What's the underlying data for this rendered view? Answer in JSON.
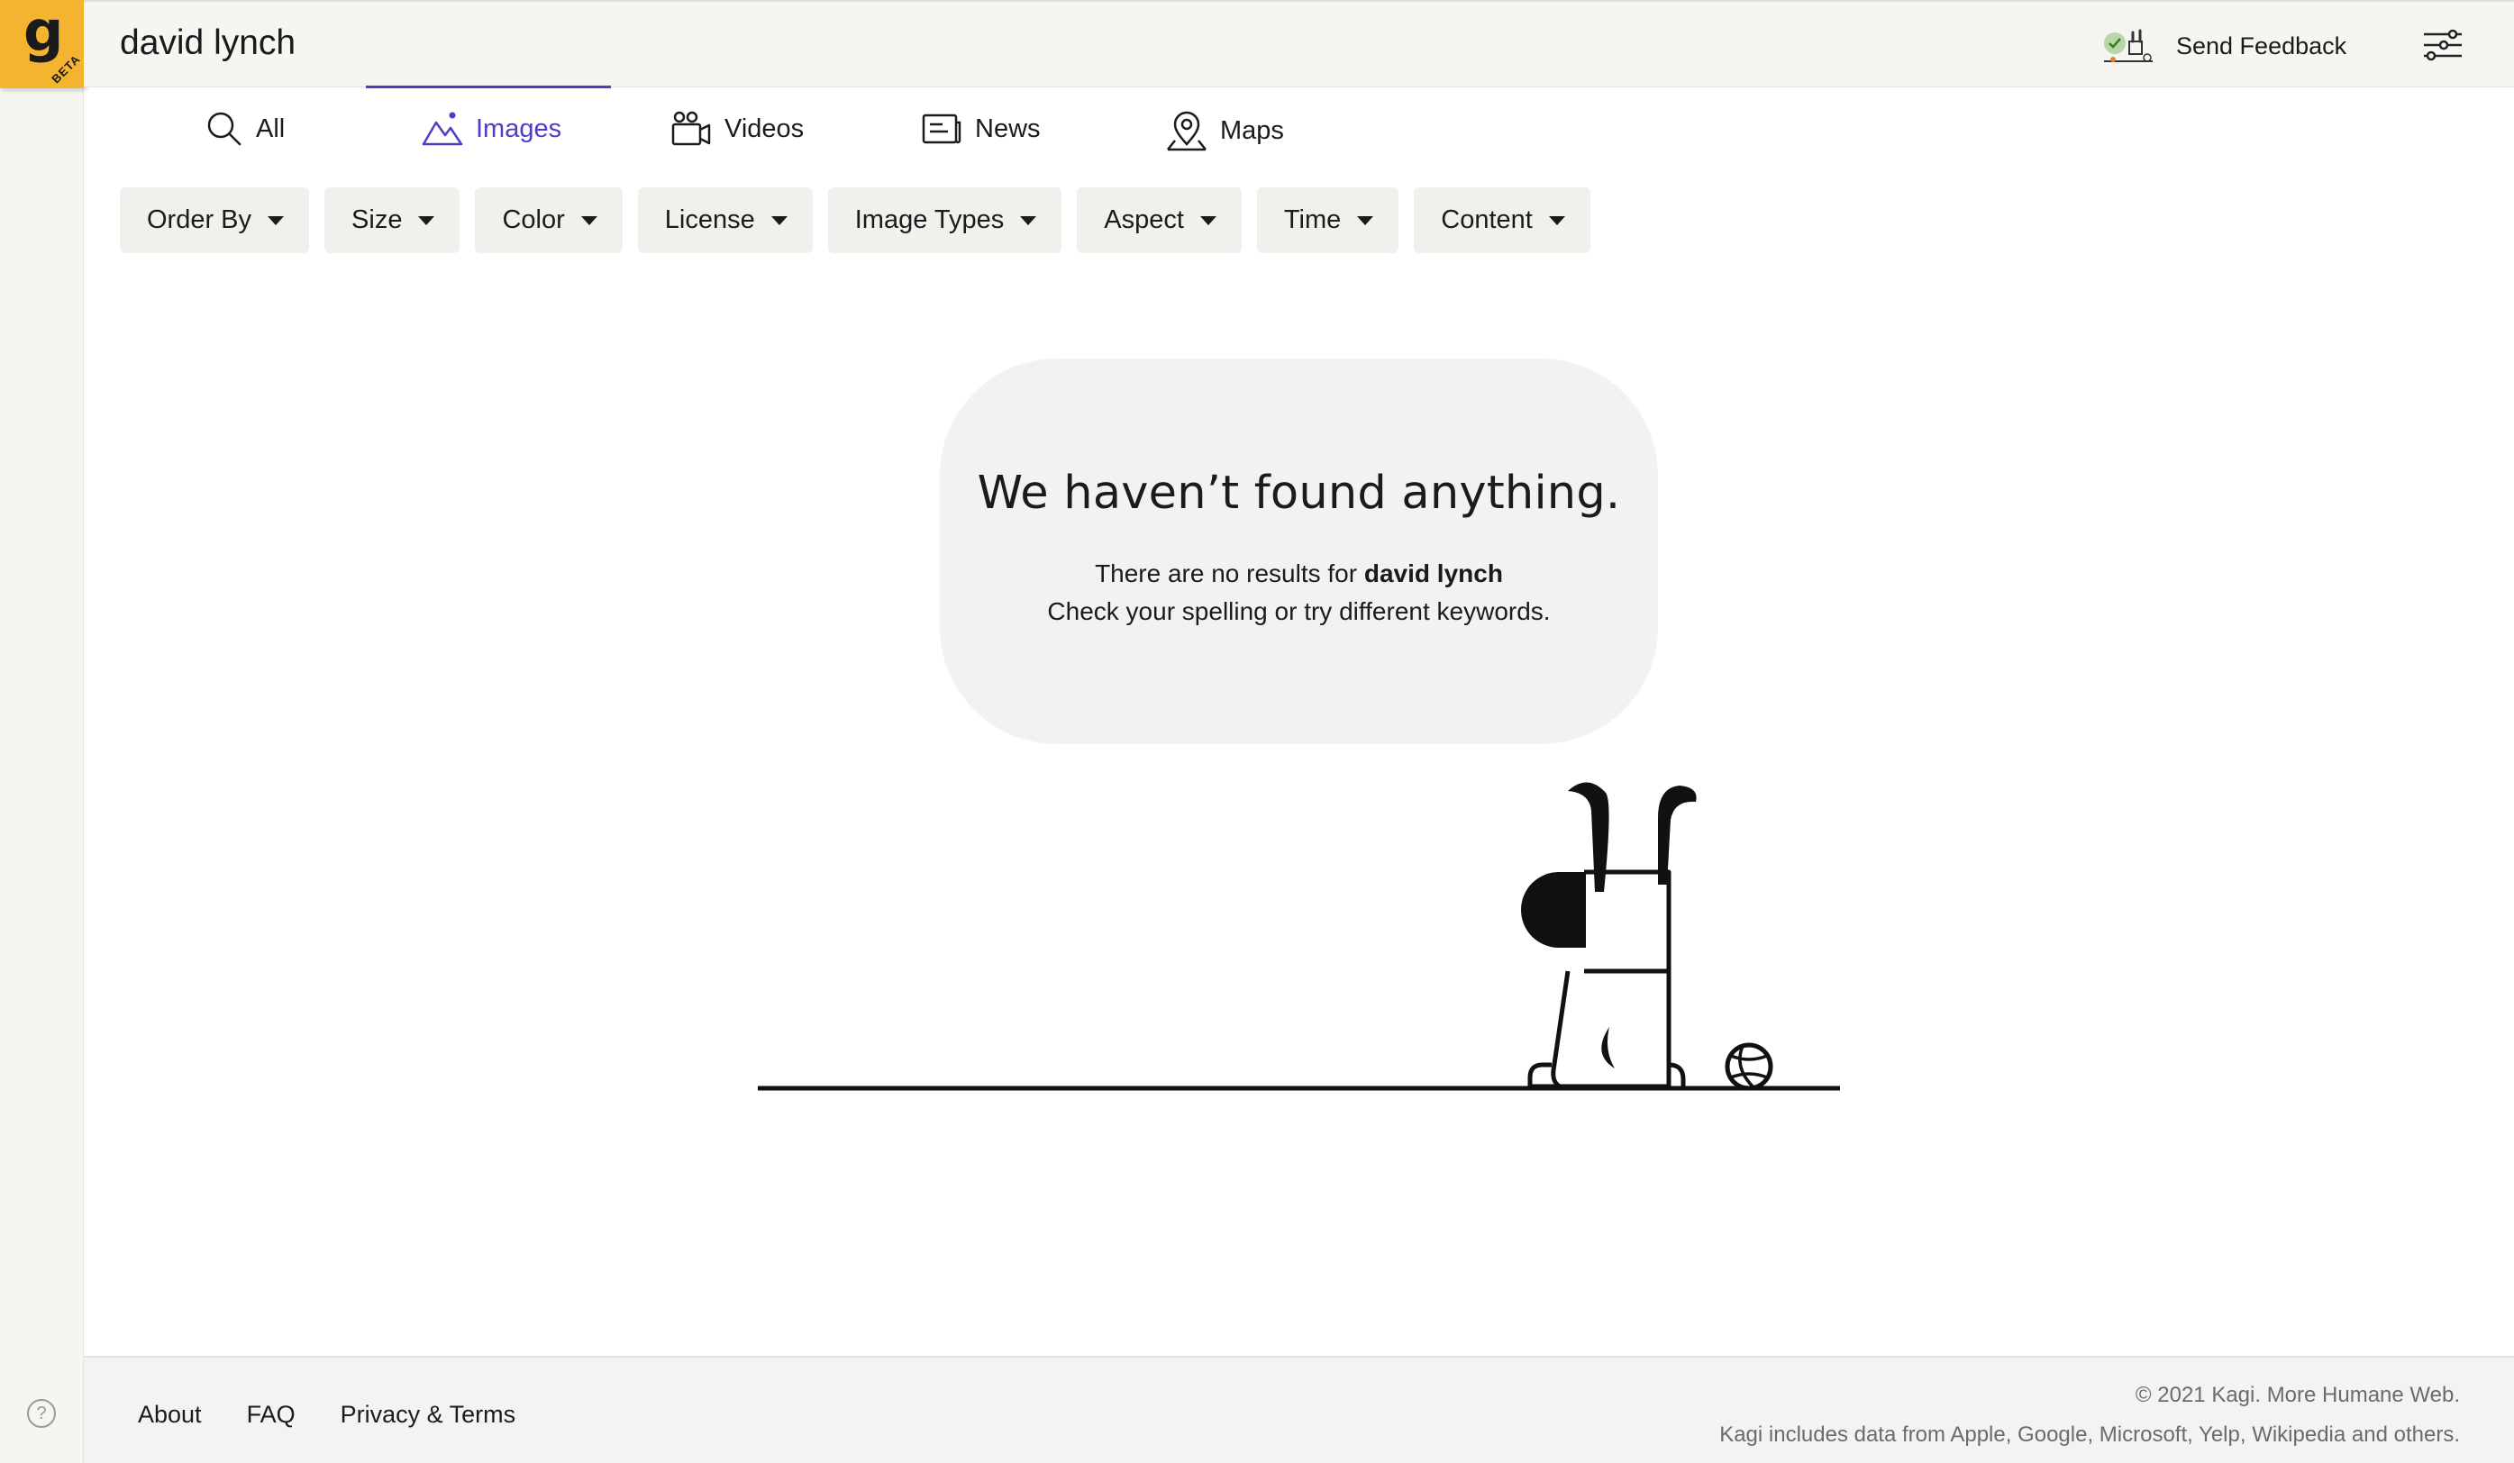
{
  "app": {
    "logo_letter": "g",
    "badge": "BETA",
    "query": "david lynch",
    "help_glyph": "?"
  },
  "header": {
    "feedback_label": "Send Feedback",
    "feedback_icon": "feedback-illustration-icon",
    "settings_icon": "settings-sliders-icon"
  },
  "tabs": [
    {
      "label": "All",
      "icon": "search-icon",
      "active": false
    },
    {
      "label": "Images",
      "icon": "image-icon",
      "active": true
    },
    {
      "label": "Videos",
      "icon": "video-camera-icon",
      "active": false
    },
    {
      "label": "News",
      "icon": "news-icon",
      "active": false
    },
    {
      "label": "Maps",
      "icon": "map-pin-icon",
      "active": false
    }
  ],
  "filters": [
    {
      "label": "Order By"
    },
    {
      "label": "Size"
    },
    {
      "label": "Color"
    },
    {
      "label": "License"
    },
    {
      "label": "Image Types"
    },
    {
      "label": "Aspect"
    },
    {
      "label": "Time"
    },
    {
      "label": "Content"
    }
  ],
  "empty_state": {
    "title": "We haven’t found anything.",
    "line1_prefix": "There are no results for ",
    "line1_query": "david lynch",
    "line2": "Check your spelling or try different keywords.",
    "illustration": "upside-down-dog-illustration"
  },
  "footer": {
    "links": [
      "About",
      "FAQ",
      "Privacy & Terms"
    ],
    "copyright": "© 2021 Kagi. More Humane Web.",
    "credits": "Kagi includes data from Apple, Google, Microsoft, Yelp, Wikipedia and others."
  },
  "colors": {
    "accent": "#4b3ec7",
    "logo": "#f4b430",
    "bubble": "#f2f2f2"
  }
}
